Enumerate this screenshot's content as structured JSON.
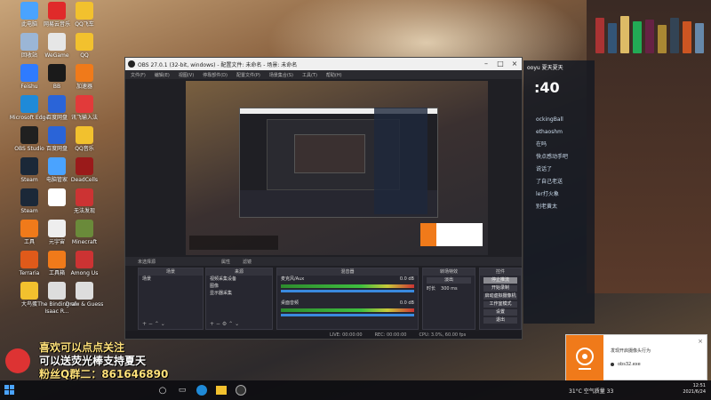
{
  "desktop": {
    "icons": [
      {
        "label": "此电脑",
        "color": "#4aa3ff"
      },
      {
        "label": "网易云音乐",
        "color": "#e02a2a"
      },
      {
        "label": "QQ飞车",
        "color": "#f2c12e"
      },
      {
        "label": "回收站",
        "color": "#9bb6d6"
      },
      {
        "label": "WeGame",
        "color": "#e6e6e6"
      },
      {
        "label": "QQ",
        "color": "#f2c12e"
      },
      {
        "label": "Feishu",
        "color": "#2f7bff"
      },
      {
        "label": "BB",
        "color": "#1a1a1a"
      },
      {
        "label": "加速器",
        "color": "#f07a1a"
      },
      {
        "label": "Microsoft Edge",
        "color": "#1f8ad8"
      },
      {
        "label": "百度网盘",
        "color": "#2a64d8"
      },
      {
        "label": "讯飞输入法",
        "color": "#e23a3a"
      },
      {
        "label": "OBS Studio",
        "color": "#202020"
      },
      {
        "label": "百度网盘",
        "color": "#2a64d8"
      },
      {
        "label": "QQ音乐",
        "color": "#f2c12e"
      },
      {
        "label": "Steam",
        "color": "#1b2838"
      },
      {
        "label": "电脑管家",
        "color": "#4aa3ff"
      },
      {
        "label": "DeadCells",
        "color": "#9a1a1a"
      },
      {
        "label": "Steam",
        "color": "#1b2838"
      },
      {
        "label": "",
        "color": "#ffffff"
      },
      {
        "label": "无法发现",
        "color": "#c33"
      },
      {
        "label": "工具",
        "color": "#f07a1a"
      },
      {
        "label": "元宇宙",
        "color": "#eee"
      },
      {
        "label": "Minecraft",
        "color": "#6a8a3a"
      },
      {
        "label": "Terraria",
        "color": "#e05a1a"
      },
      {
        "label": "工具箱",
        "color": "#f07a1a"
      },
      {
        "label": "Among Us",
        "color": "#c33"
      },
      {
        "label": "大鸟蛋",
        "color": "#f2c12e"
      },
      {
        "label": "The Binding of Isaac R...",
        "color": "#ddd"
      },
      {
        "label": "Draw & Guess",
        "color": "#ddd"
      }
    ]
  },
  "obs": {
    "title": "OBS 27.0.1 (32-bit, windows) - 配置文件: 未命名 - 场景: 未命名",
    "menu": [
      "文件(F)",
      "编辑(E)",
      "视图(V)",
      "停靠部件(D)",
      "配置文件(P)",
      "场景集合(S)",
      "工具(T)",
      "帮助(H)"
    ],
    "source_bar": {
      "selection": "未选择源",
      "properties": "属性",
      "filters": "滤镜"
    },
    "panels": {
      "scenes": {
        "title": "场景",
        "items": [
          "场景"
        ]
      },
      "sources": {
        "title": "来源",
        "items": [
          "视频采集设备",
          "图像",
          "显示器采集"
        ]
      },
      "mixer": {
        "title": "混音器",
        "tracks": [
          {
            "name": "麦克风/Aux",
            "level": "0.0 dB"
          },
          {
            "name": "桌面音频",
            "level": "0.0 dB"
          }
        ]
      },
      "transitions": {
        "title": "转场特效",
        "type": "淡出",
        "duration_label": "时长",
        "duration": "300 ms"
      },
      "controls": {
        "title": "控件",
        "buttons": [
          "停止推流",
          "开始录制",
          "启动虚拟摄像机",
          "工作室模式",
          "设置",
          "退出"
        ]
      }
    },
    "status": {
      "live": "LIVE: 00:00:00",
      "rec": "REC: 00:00:00",
      "cpu": "CPU: 3.0%, 60.00 fps"
    }
  },
  "chat": {
    "header": "ooyu 夏天夏天",
    "timer": ":40",
    "lines": [
      "ockingBall",
      "ethaoshm",
      "在吗",
      "快点感动手吧",
      "说话了",
      "了自己老送",
      "ler打火象",
      "别老黄太"
    ]
  },
  "toast": {
    "title": "发现开启摄像头行为",
    "file": "obs32.exe"
  },
  "banner": {
    "line1": "喜欢可以点点关注",
    "line2": "可以送荧光棒支持夏天",
    "line3": "粉丝Q群二：861646890"
  },
  "taskbar": {
    "weather": "31°C 空气质量 33",
    "time": "12:51",
    "date": "2021/6/24"
  }
}
